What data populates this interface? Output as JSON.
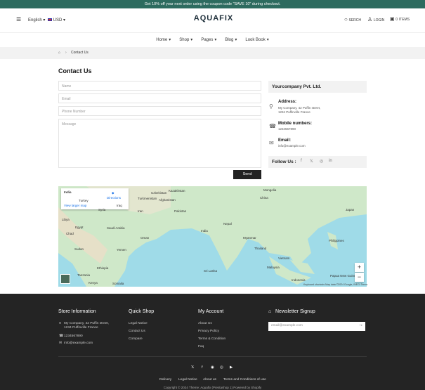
{
  "announcement": "Get 10% off your next order using the coupon code \"SAVE 10\" during checkout.",
  "header": {
    "language": "English",
    "currency": "USD",
    "logo": "AQUAFIX",
    "search_label": "SERCH",
    "login_label": "LOGIN",
    "cart_count": "0",
    "cart_label": "ITEMS"
  },
  "nav": [
    "Home",
    "Shop",
    "Pages",
    "Blog",
    "Look Book"
  ],
  "breadcrumb": {
    "current": "Contact Us"
  },
  "contact": {
    "title": "Contact Us",
    "name_placeholder": "Name",
    "email_placeholder": "Email",
    "phone_placeholder": "Phone Number",
    "message_placeholder": "Message",
    "send_label": "Send"
  },
  "info": {
    "company": "Yourcompany Pvt. Ltd.",
    "address_label": "Address:",
    "address_line1": "My Company, 42 Puffin street,",
    "address_line2": "1234 Puffinville France",
    "mobile_label": "Mobile numbers:",
    "mobile_value": "1234567890",
    "email_label": "Email:",
    "email_value": "info@example.com",
    "follow_label": "Follow Us :"
  },
  "map": {
    "place": "India",
    "directions": "Directions",
    "larger_map": "View larger map",
    "attribution": "Keyboard shortcuts   Map data ©2024 Google, INEGI   Terms",
    "labels": [
      "Afghanistan",
      "Pakistan",
      "India",
      "China",
      "Iran",
      "Iraq",
      "Saudi Arabia",
      "Oman",
      "Yemen",
      "Sudan",
      "Ethiopia",
      "Kenya",
      "Somalia",
      "Egypt",
      "Thailand",
      "Myanmar",
      "Philippines",
      "Malaysia",
      "Indonesia",
      "Sri Lanka",
      "Mongolia",
      "Japan",
      "Kazakhstan",
      "Turkey",
      "Libya",
      "Chad",
      "Nepal",
      "Vietnam",
      "Uzbekistan",
      "Syria",
      "Turkmenistan",
      "Tanzania",
      "Papua New Guinea"
    ],
    "zoom_in": "+",
    "zoom_out": "−"
  },
  "footer": {
    "store_title": "Store Information",
    "store_address1": "My Company, 42 Puffin street,",
    "store_address2": "1234 Puffinville France",
    "store_phone": "1234567890",
    "store_email": "info@example.com",
    "quick_title": "Quick Shop",
    "quick_links": [
      "Legal Notice",
      "Contact Us",
      "Compare"
    ],
    "account_title": "My Account",
    "account_links": [
      "About Us",
      "Privacy Policy",
      "Terms & Condition",
      "Faq"
    ],
    "newsletter_title": "Newsletter Signup",
    "newsletter_placeholder": "email@example.com",
    "bottom_links": [
      "Delivery",
      "Legal Notice",
      "About us",
      "Terms and Conditions of use"
    ],
    "copyright": "Copyright © 2024 Theme: Aquafix (Prestashop 1)   Powered by Shopify"
  },
  "colors": {
    "announce": "#2d6b5f",
    "footer": "#242424",
    "map_water": "#9fdbe8",
    "map_land": "#cfe8c9"
  }
}
